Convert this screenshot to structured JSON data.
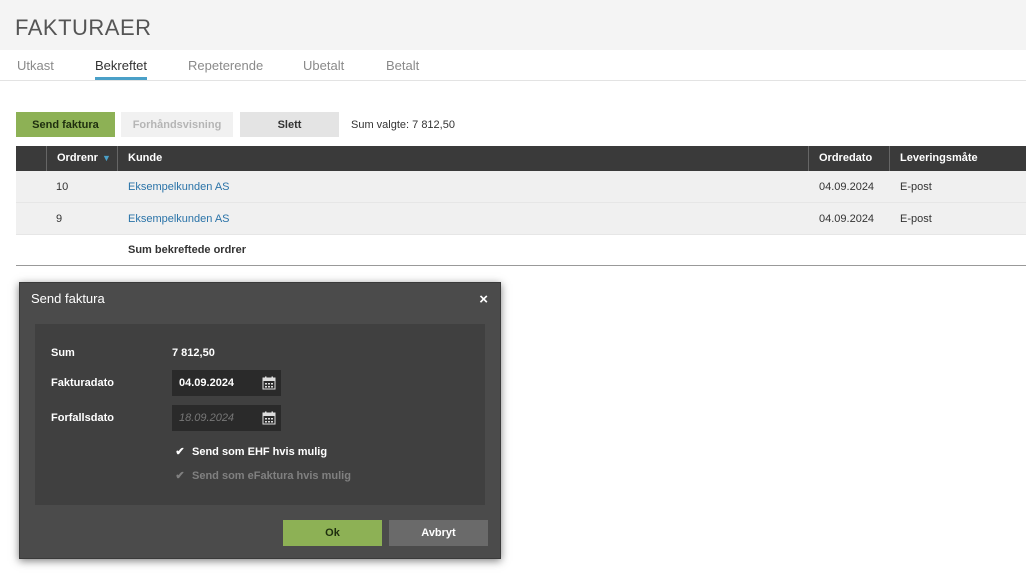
{
  "page": {
    "title": "FAKTURAER"
  },
  "tabs": [
    {
      "label": "Utkast",
      "active": false
    },
    {
      "label": "Bekreftet",
      "active": true
    },
    {
      "label": "Repeterende",
      "active": false
    },
    {
      "label": "Ubetalt",
      "active": false
    },
    {
      "label": "Betalt",
      "active": false
    }
  ],
  "toolbar": {
    "send_label": "Send faktura",
    "preview_label": "Forhåndsvisning",
    "delete_label": "Slett",
    "sum_selected": "Sum valgte: 7 812,50"
  },
  "table": {
    "columns": [
      "Ordrenr",
      "Kunde",
      "Ordredato",
      "Leveringsmåte"
    ],
    "rows": [
      {
        "ordrenr": "10",
        "kunde": "Eksempelkunden AS",
        "ordredato": "04.09.2024",
        "levering": "E-post"
      },
      {
        "ordrenr": "9",
        "kunde": "Eksempelkunden AS",
        "ordredato": "04.09.2024",
        "levering": "E-post"
      }
    ],
    "sum_label": "Sum bekreftede ordrer"
  },
  "modal": {
    "title": "Send faktura",
    "close": "×",
    "sum_label": "Sum",
    "sum_value": "7 812,50",
    "invoice_date_label": "Fakturadato",
    "invoice_date_value": "04.09.2024",
    "due_date_label": "Forfallsdato",
    "due_date_value": "18.09.2024",
    "ehf_label": "Send som EHF hvis mulig",
    "efaktura_label": "Send som eFaktura hvis mulig",
    "ok_label": "Ok",
    "cancel_label": "Avbryt"
  },
  "colors": {
    "accent_green": "#8db155",
    "tab_underline": "#4aa0c8",
    "link": "#2a73a8",
    "header_dark": "#3a3a3a"
  }
}
